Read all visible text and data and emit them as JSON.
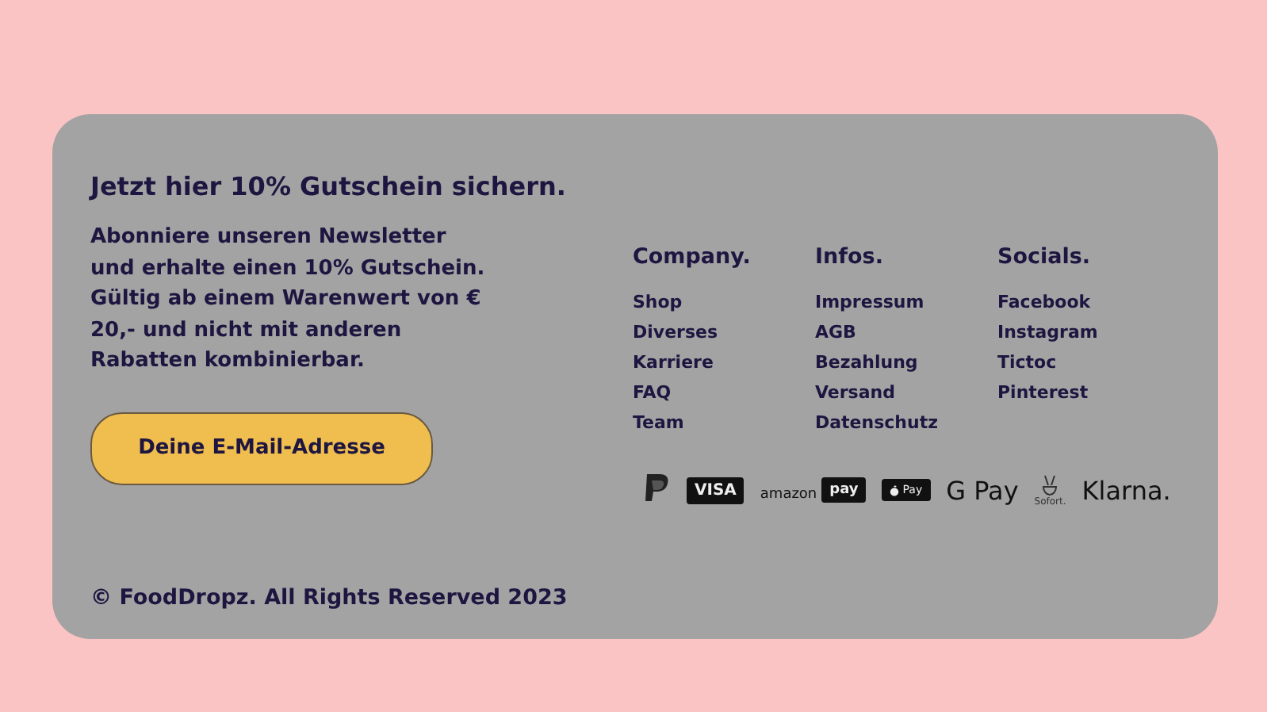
{
  "newsletter": {
    "title": "Jetzt hier 10% Gutschein sichern.",
    "paragraphs": [
      "Abonniere unseren Newsletter und erhalte einen 10% Gutschein.",
      "Gültig ab einem Warenwert von € 20,- und nicht mit anderen Rabatten kombinierbar."
    ],
    "email_button": "Deine E-Mail-Adresse"
  },
  "columns": [
    {
      "title": "Company.",
      "links": [
        "Shop",
        "Diverses",
        "Karriere",
        "FAQ",
        "Team"
      ]
    },
    {
      "title": "Infos.",
      "links": [
        "Impressum",
        "AGB",
        "Bezahlung",
        "Versand",
        "Datenschutz"
      ]
    },
    {
      "title": "Socials.",
      "links": [
        "Facebook",
        "Instagram",
        "Tictoc",
        "Pinterest"
      ]
    }
  ],
  "payments": [
    {
      "kind": "paypal"
    },
    {
      "kind": "card",
      "label": "VISA"
    },
    {
      "kind": "amazon",
      "label": "amazon",
      "badge": "pay"
    },
    {
      "kind": "apple",
      "label": "Pay"
    },
    {
      "kind": "text",
      "label": "G Pay"
    },
    {
      "kind": "sofort",
      "label": "Sofort."
    },
    {
      "kind": "text",
      "label": "Klarna."
    }
  ],
  "copyright": "© FoodDropz. All Rights Reserved 2023"
}
